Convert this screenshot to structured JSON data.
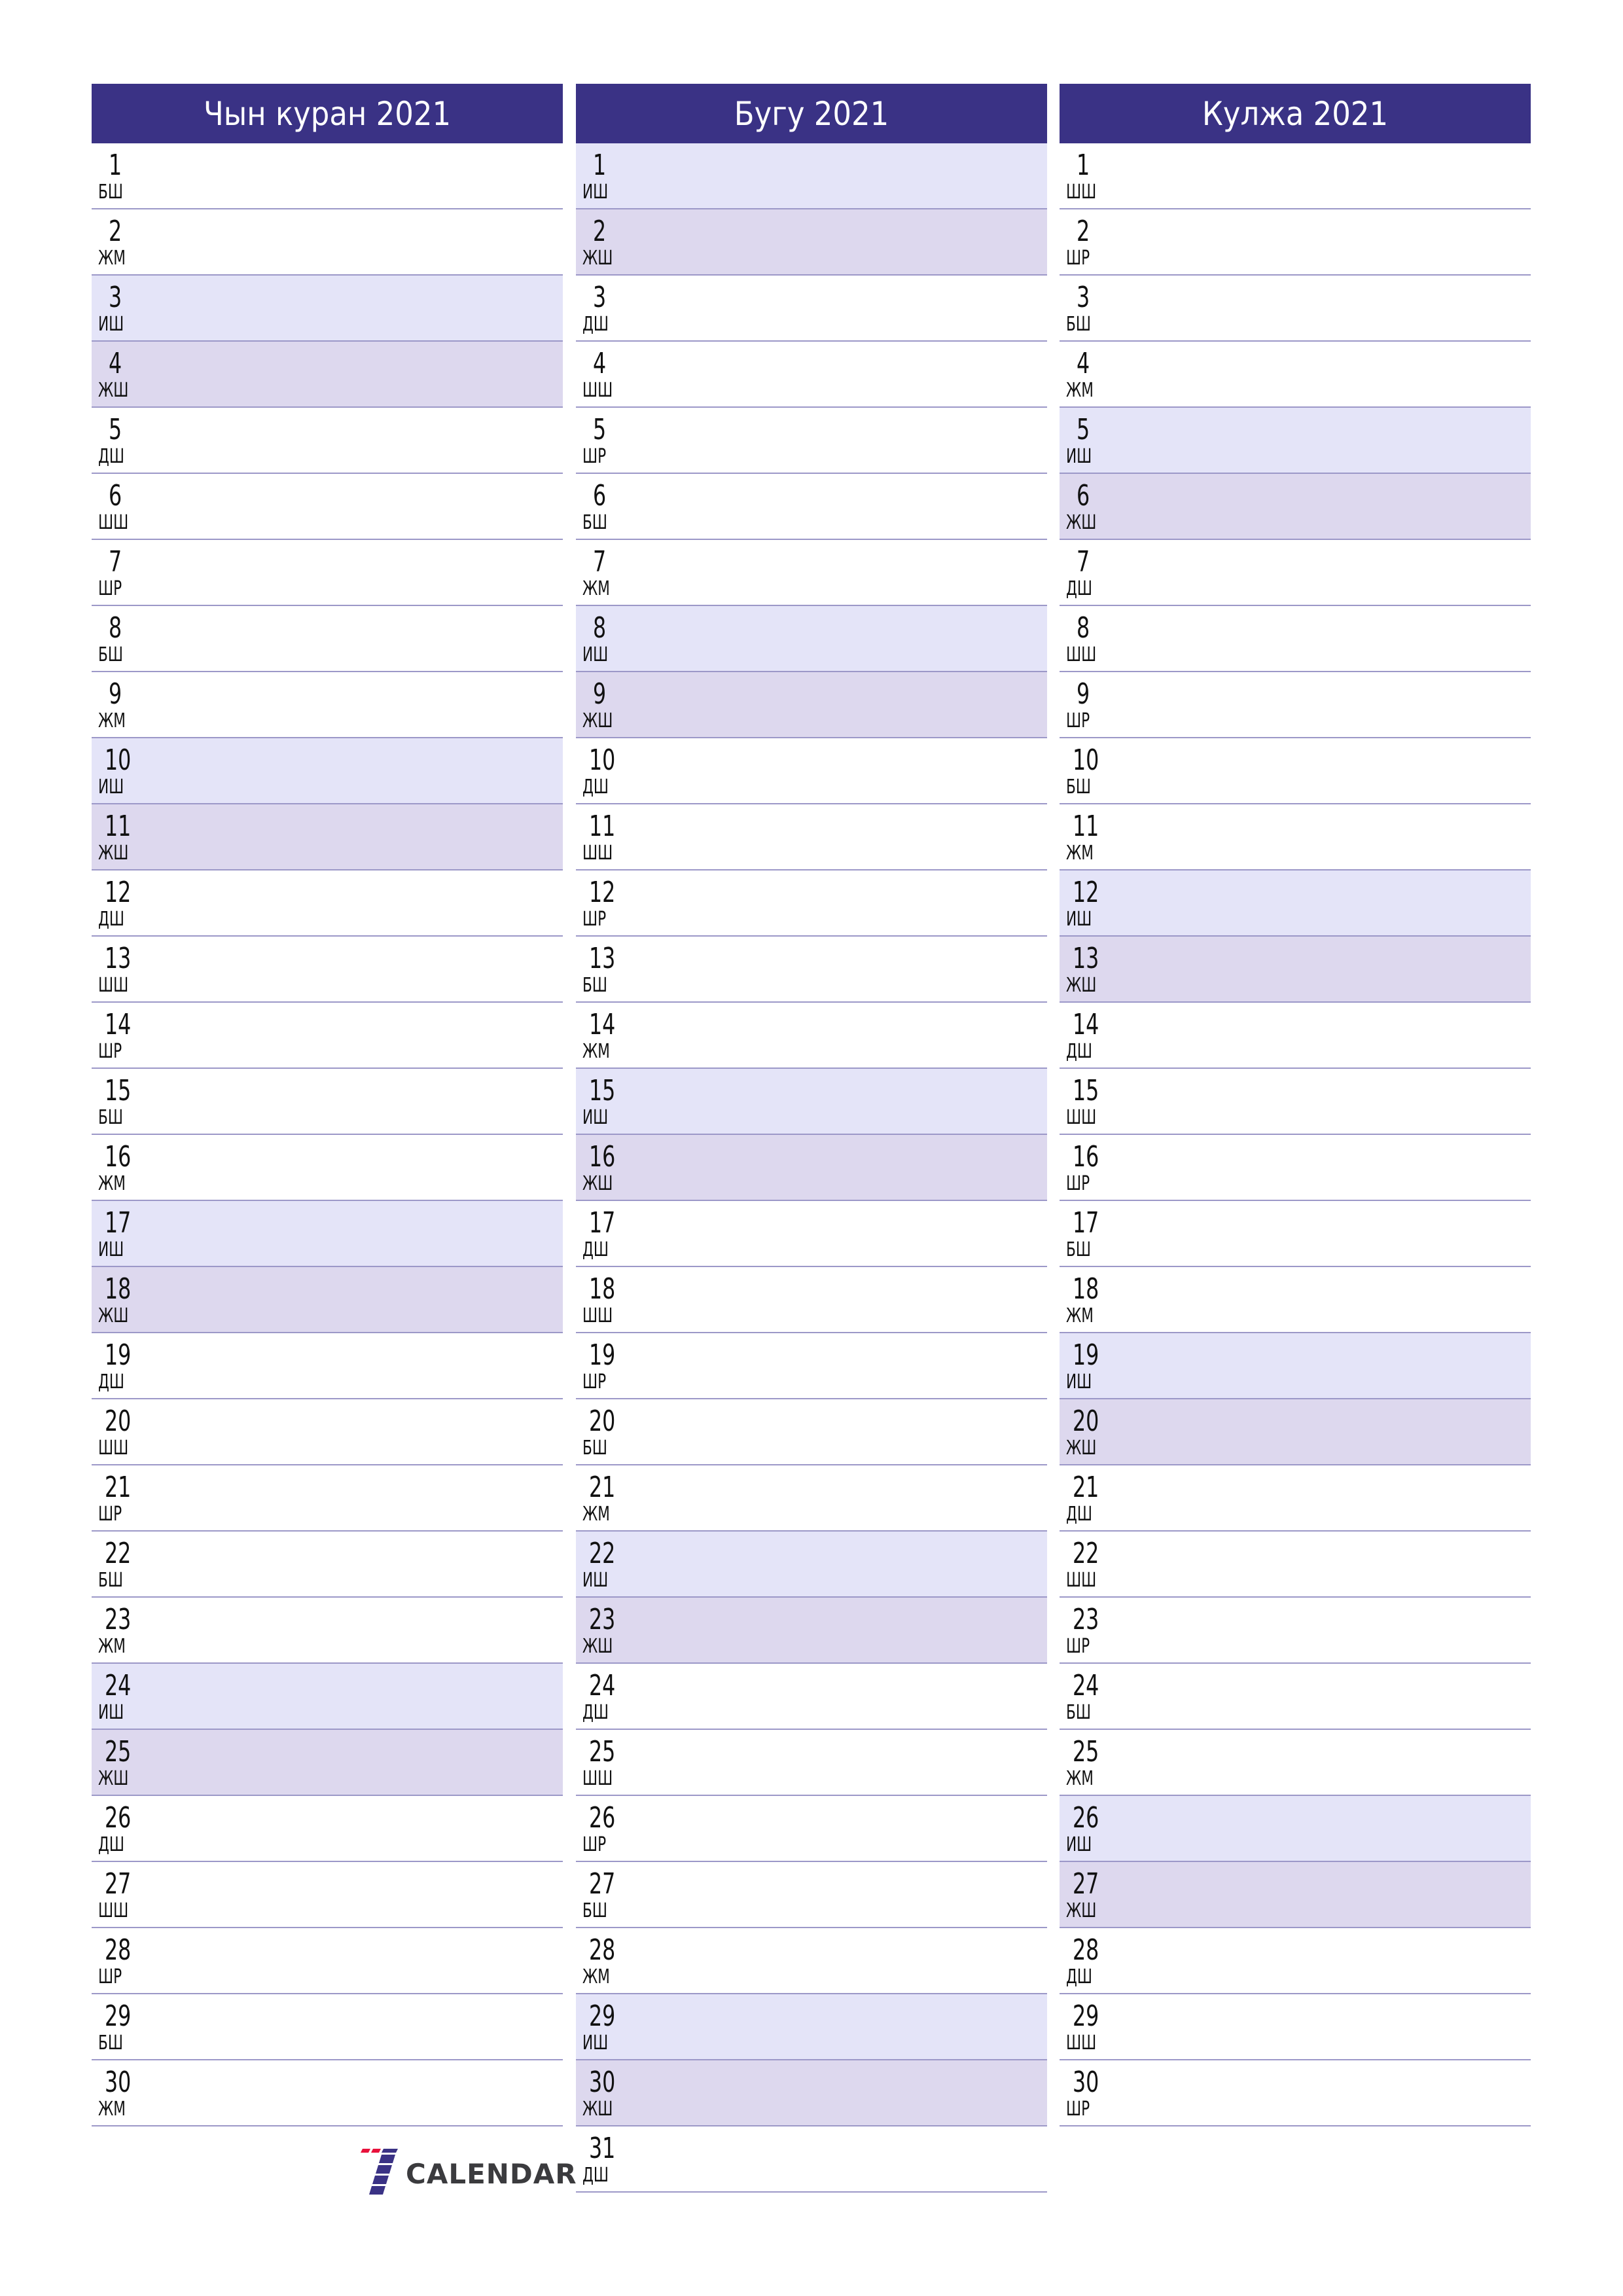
{
  "colors": {
    "header_bg": "#3a3285",
    "saturday_bg": "#e4e4f8",
    "sunday_bg": "#ddd8ee",
    "divider": "#9c98c8",
    "logo_red": "#e8123c",
    "logo_blue": "#3a3285"
  },
  "months": [
    {
      "title": "Чын куран 2021",
      "days": [
        {
          "n": "1",
          "d": "БШ",
          "t": ""
        },
        {
          "n": "2",
          "d": "ЖМ",
          "t": ""
        },
        {
          "n": "3",
          "d": "ИШ",
          "t": "sat"
        },
        {
          "n": "4",
          "d": "ЖШ",
          "t": "sun"
        },
        {
          "n": "5",
          "d": "ДШ",
          "t": ""
        },
        {
          "n": "6",
          "d": "ШШ",
          "t": ""
        },
        {
          "n": "7",
          "d": "ШР",
          "t": ""
        },
        {
          "n": "8",
          "d": "БШ",
          "t": ""
        },
        {
          "n": "9",
          "d": "ЖМ",
          "t": ""
        },
        {
          "n": "10",
          "d": "ИШ",
          "t": "sat"
        },
        {
          "n": "11",
          "d": "ЖШ",
          "t": "sun"
        },
        {
          "n": "12",
          "d": "ДШ",
          "t": ""
        },
        {
          "n": "13",
          "d": "ШШ",
          "t": ""
        },
        {
          "n": "14",
          "d": "ШР",
          "t": ""
        },
        {
          "n": "15",
          "d": "БШ",
          "t": ""
        },
        {
          "n": "16",
          "d": "ЖМ",
          "t": ""
        },
        {
          "n": "17",
          "d": "ИШ",
          "t": "sat"
        },
        {
          "n": "18",
          "d": "ЖШ",
          "t": "sun"
        },
        {
          "n": "19",
          "d": "ДШ",
          "t": ""
        },
        {
          "n": "20",
          "d": "ШШ",
          "t": ""
        },
        {
          "n": "21",
          "d": "ШР",
          "t": ""
        },
        {
          "n": "22",
          "d": "БШ",
          "t": ""
        },
        {
          "n": "23",
          "d": "ЖМ",
          "t": ""
        },
        {
          "n": "24",
          "d": "ИШ",
          "t": "sat"
        },
        {
          "n": "25",
          "d": "ЖШ",
          "t": "sun"
        },
        {
          "n": "26",
          "d": "ДШ",
          "t": ""
        },
        {
          "n": "27",
          "d": "ШШ",
          "t": ""
        },
        {
          "n": "28",
          "d": "ШР",
          "t": ""
        },
        {
          "n": "29",
          "d": "БШ",
          "t": ""
        },
        {
          "n": "30",
          "d": "ЖМ",
          "t": ""
        }
      ]
    },
    {
      "title": "Бугу 2021",
      "days": [
        {
          "n": "1",
          "d": "ИШ",
          "t": "sat"
        },
        {
          "n": "2",
          "d": "ЖШ",
          "t": "sun"
        },
        {
          "n": "3",
          "d": "ДШ",
          "t": ""
        },
        {
          "n": "4",
          "d": "ШШ",
          "t": ""
        },
        {
          "n": "5",
          "d": "ШР",
          "t": ""
        },
        {
          "n": "6",
          "d": "БШ",
          "t": ""
        },
        {
          "n": "7",
          "d": "ЖМ",
          "t": ""
        },
        {
          "n": "8",
          "d": "ИШ",
          "t": "sat"
        },
        {
          "n": "9",
          "d": "ЖШ",
          "t": "sun"
        },
        {
          "n": "10",
          "d": "ДШ",
          "t": ""
        },
        {
          "n": "11",
          "d": "ШШ",
          "t": ""
        },
        {
          "n": "12",
          "d": "ШР",
          "t": ""
        },
        {
          "n": "13",
          "d": "БШ",
          "t": ""
        },
        {
          "n": "14",
          "d": "ЖМ",
          "t": ""
        },
        {
          "n": "15",
          "d": "ИШ",
          "t": "sat"
        },
        {
          "n": "16",
          "d": "ЖШ",
          "t": "sun"
        },
        {
          "n": "17",
          "d": "ДШ",
          "t": ""
        },
        {
          "n": "18",
          "d": "ШШ",
          "t": ""
        },
        {
          "n": "19",
          "d": "ШР",
          "t": ""
        },
        {
          "n": "20",
          "d": "БШ",
          "t": ""
        },
        {
          "n": "21",
          "d": "ЖМ",
          "t": ""
        },
        {
          "n": "22",
          "d": "ИШ",
          "t": "sat"
        },
        {
          "n": "23",
          "d": "ЖШ",
          "t": "sun"
        },
        {
          "n": "24",
          "d": "ДШ",
          "t": ""
        },
        {
          "n": "25",
          "d": "ШШ",
          "t": ""
        },
        {
          "n": "26",
          "d": "ШР",
          "t": ""
        },
        {
          "n": "27",
          "d": "БШ",
          "t": ""
        },
        {
          "n": "28",
          "d": "ЖМ",
          "t": ""
        },
        {
          "n": "29",
          "d": "ИШ",
          "t": "sat"
        },
        {
          "n": "30",
          "d": "ЖШ",
          "t": "sun"
        },
        {
          "n": "31",
          "d": "ДШ",
          "t": ""
        }
      ]
    },
    {
      "title": "Кулжа 2021",
      "days": [
        {
          "n": "1",
          "d": "ШШ",
          "t": ""
        },
        {
          "n": "2",
          "d": "ШР",
          "t": ""
        },
        {
          "n": "3",
          "d": "БШ",
          "t": ""
        },
        {
          "n": "4",
          "d": "ЖМ",
          "t": ""
        },
        {
          "n": "5",
          "d": "ИШ",
          "t": "sat"
        },
        {
          "n": "6",
          "d": "ЖШ",
          "t": "sun"
        },
        {
          "n": "7",
          "d": "ДШ",
          "t": ""
        },
        {
          "n": "8",
          "d": "ШШ",
          "t": ""
        },
        {
          "n": "9",
          "d": "ШР",
          "t": ""
        },
        {
          "n": "10",
          "d": "БШ",
          "t": ""
        },
        {
          "n": "11",
          "d": "ЖМ",
          "t": ""
        },
        {
          "n": "12",
          "d": "ИШ",
          "t": "sat"
        },
        {
          "n": "13",
          "d": "ЖШ",
          "t": "sun"
        },
        {
          "n": "14",
          "d": "ДШ",
          "t": ""
        },
        {
          "n": "15",
          "d": "ШШ",
          "t": ""
        },
        {
          "n": "16",
          "d": "ШР",
          "t": ""
        },
        {
          "n": "17",
          "d": "БШ",
          "t": ""
        },
        {
          "n": "18",
          "d": "ЖМ",
          "t": ""
        },
        {
          "n": "19",
          "d": "ИШ",
          "t": "sat"
        },
        {
          "n": "20",
          "d": "ЖШ",
          "t": "sun"
        },
        {
          "n": "21",
          "d": "ДШ",
          "t": ""
        },
        {
          "n": "22",
          "d": "ШШ",
          "t": ""
        },
        {
          "n": "23",
          "d": "ШР",
          "t": ""
        },
        {
          "n": "24",
          "d": "БШ",
          "t": ""
        },
        {
          "n": "25",
          "d": "ЖМ",
          "t": ""
        },
        {
          "n": "26",
          "d": "ИШ",
          "t": "sat"
        },
        {
          "n": "27",
          "d": "ЖШ",
          "t": "sun"
        },
        {
          "n": "28",
          "d": "ДШ",
          "t": ""
        },
        {
          "n": "29",
          "d": "ШШ",
          "t": ""
        },
        {
          "n": "30",
          "d": "ШР",
          "t": ""
        }
      ]
    }
  ],
  "logo": {
    "text": "CALENDAR",
    "icon": "seven-logo-icon"
  }
}
